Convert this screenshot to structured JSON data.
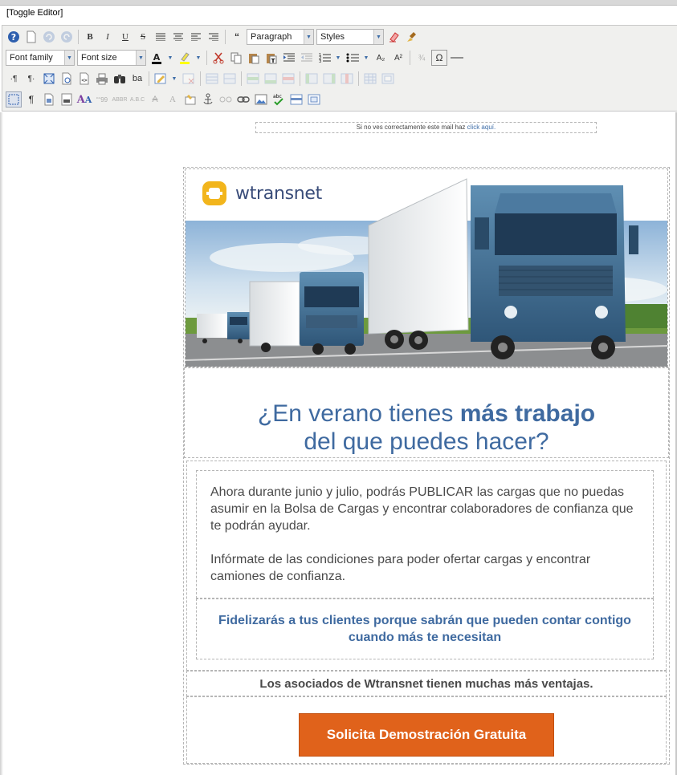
{
  "editor": {
    "toggle_label": "[Toggle Editor]",
    "block_format": "Paragraph",
    "styles": "Styles",
    "font_family": "Font family",
    "font_size": "Font size"
  },
  "toolbar_icons": {
    "row1": [
      "help-icon",
      "new-document-icon",
      "undo-icon",
      "redo-icon",
      "bold-icon",
      "italic-icon",
      "underline-icon",
      "strikethrough-icon",
      "align-justify-icon",
      "align-center-icon",
      "align-left-icon",
      "align-right-icon",
      "blockquote-icon",
      "remove-format-icon",
      "cleanup-icon"
    ],
    "row2": [
      "text-color-icon",
      "highlight-color-icon",
      "cut-icon",
      "copy-icon",
      "paste-icon",
      "paste-text-icon",
      "indent-icon",
      "outdent-icon",
      "numbered-list-icon",
      "bullet-list-icon",
      "subscript-icon",
      "superscript-icon",
      "special-char-icon",
      "omega-icon",
      "horizontal-rule-icon"
    ],
    "row3": [
      "ltr-icon",
      "rtl-icon",
      "fullscreen-icon",
      "preview-icon",
      "source-code-icon",
      "print-icon",
      "find-icon",
      "replace-icon",
      "insert-layer-icon",
      "table-icon",
      "table-row-icon",
      "table-col-icon",
      "table-cell-icon"
    ],
    "row4": [
      "visual-aid-icon",
      "paragraph-mark-icon",
      "template-icon",
      "page-break-icon",
      "styles-icon",
      "citation-icon",
      "abbreviation-icon",
      "acronym-icon",
      "delete-text-icon",
      "insert-text-icon",
      "attributes-icon",
      "anchor-icon",
      "unlink-icon",
      "link-icon",
      "image-icon",
      "spellcheck-icon",
      "layer-icon",
      "media-icon"
    ]
  },
  "email": {
    "preheader_text": "Si no ves correctamente este mail haz",
    "preheader_link": "click aquí.",
    "logo_text": "wtransnet",
    "headline_line1_normal": "¿En verano tienes",
    "headline_line1_bold": "más trabajo",
    "headline_line2": "del que puedes hacer?",
    "paragraph1": "Ahora durante junio y julio, podrás PUBLICAR las cargas que no puedas asumir en la Bolsa de Cargas y encontrar colaboradores de confianza que te podrán ayudar.",
    "paragraph2": "Infórmate de las condiciones para poder ofertar cargas y encontrar camiones de confianza.",
    "highlight": "Fidelizarás a tus clientes porque sabrán que pueden contar contigo cuando más te necesitan",
    "associates": "Los asociados de Wtransnet tienen muchas más ventajas.",
    "cta_label": "Solicita Demostración Gratuita"
  },
  "colors": {
    "brand_blue": "#3f6aa0",
    "cta_orange": "#e0621b",
    "logo_yellow": "#f2b51c"
  }
}
